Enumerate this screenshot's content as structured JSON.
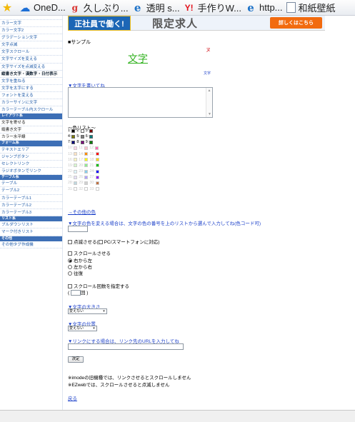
{
  "favorites": [
    {
      "icon": "star-icon",
      "label": ""
    },
    {
      "icon": "cloud-icon",
      "label": "OneD..."
    },
    {
      "icon": "google-icon",
      "label": "久しぶり..."
    },
    {
      "icon": "ie-icon",
      "label": "透明 s..."
    },
    {
      "icon": "yahoo-icon",
      "label": "手作りW..."
    },
    {
      "icon": "ie-icon",
      "label": "http..."
    },
    {
      "icon": "page-icon",
      "label": "和紙壁紙"
    }
  ],
  "sidebar": {
    "top": [
      "カラー文字",
      "カラー文字2",
      "グラデーション文字",
      "文字点滅",
      "文字スクロール",
      "文字サイズを変える",
      "文字サイズを点滅変える",
      "縦書き文字・漢数字・日付表示",
      "文字を重ねる",
      "文字を太字にする",
      "フォントを変える",
      "カラーサインに文字",
      "カラーテーブル内スクロール"
    ],
    "head1": "レイアウト系",
    "g1": [
      "文字を寄せる",
      "縦書き文字",
      "カラー水平線"
    ],
    "head2": "フォーム系",
    "g2": [
      "テキストエリア",
      "ジャンプボタン",
      "セレクトリンク",
      "ラジオボタンでリンク"
    ],
    "head3": "テーブル系",
    "g3": [
      "テーブル",
      "テーブル2",
      "カラーテーブル1",
      "カラーテーブル2",
      "カラーテーブル3"
    ],
    "head4": "リスト系",
    "g4": [
      "プルダウンリスト",
      "マーク付きリスト"
    ],
    "head5": "その他",
    "g5": [
      "その他タグ作成機"
    ]
  },
  "banner": {
    "left": "正社員で働く!",
    "title": "限定求人",
    "button": "詳しくはこちら"
  },
  "sample": {
    "label": "■サンプル",
    "text": "文字",
    "red_mark": "ヌ",
    "tiny_text": "文字"
  },
  "sections": {
    "write_text": "▼文字を書いてね",
    "color_list_title": "〜色リスト〜",
    "other_colors": "→その他の色",
    "change_color": "▼文字の色を変える場合は、文字の色の番号を上のリストから選んで入力してね(色コード可)",
    "blink_label": "点滅させる(",
    "blink_pc": "PC/スマートフォンに対応)",
    "scroll_label": "スクロールさせる",
    "scroll_options": [
      "右から左",
      "左から右",
      "往復"
    ],
    "scroll_count_label": "スクロール回数を指定する",
    "count_suffix": "回 )",
    "count_prefix": "(",
    "size_title": "▼文字の大きさ",
    "size_value": "変えない",
    "position_title": "▼文字の位置",
    "position_value": "変えない",
    "link_title": "▼リンクにする場合は、リンク先のURLを入力してね",
    "submit": "決定",
    "note1": "※imodeの旧機種では、リンクさせるとスクロールしません",
    "note2": "※EZwebでは、スクロールさせると点滅しません",
    "back": "戻る"
  },
  "colors": [
    [
      "1",
      "#000000"
    ],
    [
      "2",
      "#ffffff"
    ],
    [
      "3",
      "#800000"
    ],
    [
      "4",
      "#808000"
    ],
    [
      "5",
      "#808080"
    ],
    [
      "6",
      "#008080"
    ],
    [
      "7",
      "#000080"
    ],
    [
      "8",
      "#800080"
    ],
    [
      "9",
      "#008000"
    ],
    [
      "10",
      "#ffd6e8"
    ],
    [
      "11",
      "#ffc0cb"
    ],
    [
      "12",
      "#ff69b4"
    ],
    [
      "13",
      "#ffe4c4"
    ],
    [
      "14",
      "#ff8c00"
    ],
    [
      "15",
      "#ff0000"
    ],
    [
      "16",
      "#fff8c0"
    ],
    [
      "17",
      "#ffff00"
    ],
    [
      "18",
      "#ffd700"
    ],
    [
      "19",
      "#d8f8d0"
    ],
    [
      "20",
      "#90ee90"
    ],
    [
      "21",
      "#00c000"
    ],
    [
      "22",
      "#e0f6ff"
    ],
    [
      "23",
      "#87ceeb"
    ],
    [
      "24",
      "#0000ff"
    ],
    [
      "25",
      "#e6e0f8"
    ],
    [
      "26",
      "#b0a0ff"
    ],
    [
      "27",
      "#8000ff"
    ],
    [
      "28",
      "#c0d8e0"
    ],
    [
      "29",
      "#d0d0d0"
    ],
    [
      "30",
      "#c07040"
    ],
    [
      "31",
      "#ffffff"
    ],
    [
      "32",
      "#ffffff"
    ],
    [
      "33",
      "#ffffff"
    ]
  ]
}
